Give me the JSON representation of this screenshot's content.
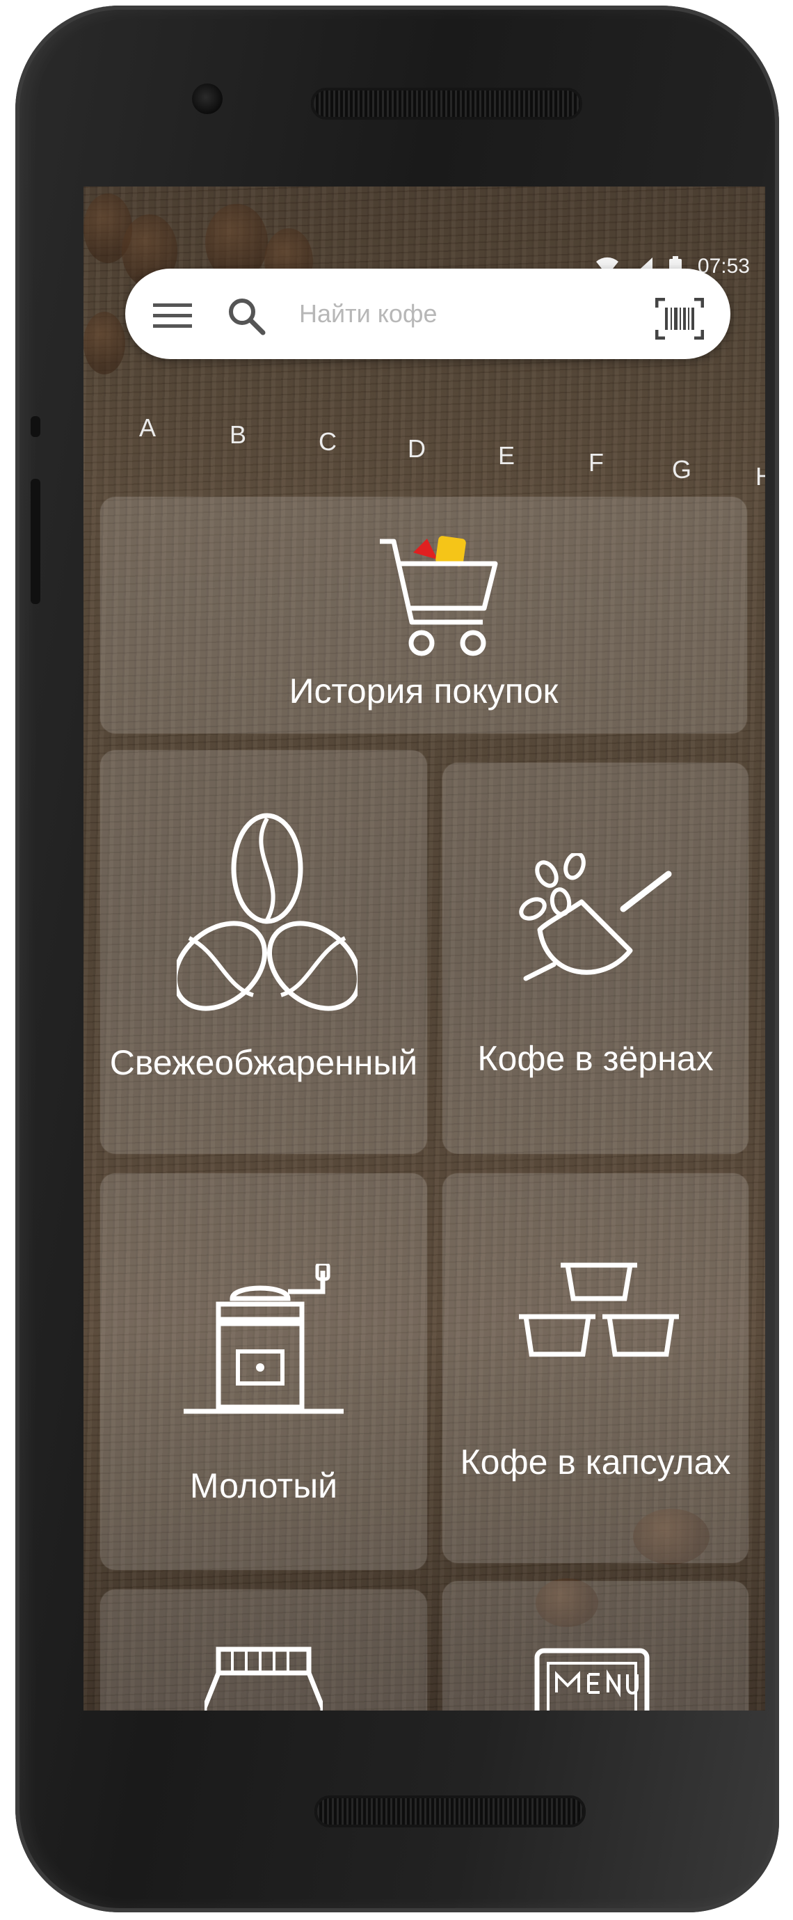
{
  "status_bar": {
    "time": "07:53",
    "icons": [
      "wifi-icon",
      "cellular-signal-icon",
      "battery-icon"
    ]
  },
  "search": {
    "placeholder": "Найти кофе",
    "menu_icon": "hamburger-menu-icon",
    "search_icon": "magnifier-icon",
    "barcode_icon": "barcode-scanner-icon"
  },
  "alphabet": [
    "A",
    "B",
    "C",
    "D",
    "E",
    "F",
    "G",
    "H"
  ],
  "tiles": [
    {
      "label": "История покупок",
      "icon": "shopping-cart-icon"
    },
    {
      "label": "Свежеобжаренный",
      "icon": "coffee-beans-icon"
    },
    {
      "label": "Кофе в зёрнах",
      "icon": "coffee-scoop-icon"
    },
    {
      "label": "Молотый",
      "icon": "coffee-grinder-icon"
    },
    {
      "label": "Кофе в капсулах",
      "icon": "coffee-capsules-icon"
    },
    {
      "label": "",
      "icon": "coffee-bag-icon"
    },
    {
      "label": "",
      "icon": "menu-board-icon"
    }
  ],
  "colors": {
    "cart_red": "#e02020",
    "cart_yellow": "#f5c518"
  }
}
